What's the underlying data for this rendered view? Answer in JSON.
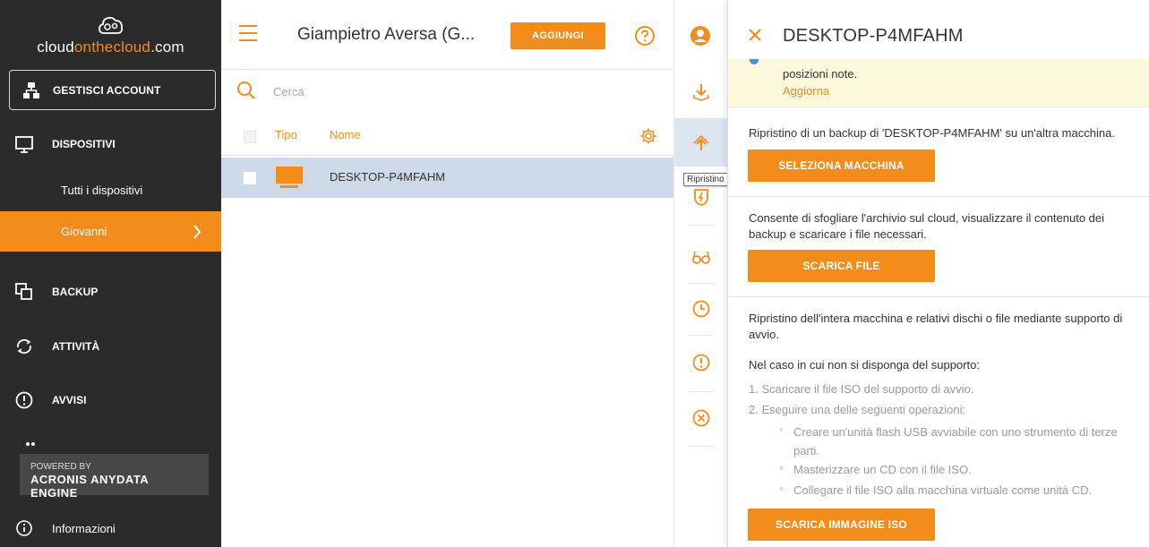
{
  "sidebar": {
    "logo": {
      "part1": "cloud",
      "part2": "onthecloud",
      "part3": ".com"
    },
    "manage_label": "GESTISCI ACCOUNT",
    "devices_label": "DISPOSITIVI",
    "all_devices_label": "Tutti i dispositivi",
    "active_group_label": "Giovanni",
    "backup_label": "BACKUP",
    "activities_label": "ATTIVITÀ",
    "alerts_label": "AVVISI",
    "powered_by": "POWERED BY",
    "engine": "ACRONIS ANYDATA ENGINE",
    "info_label": "Informazioni"
  },
  "topbar": {
    "account_name": "Giampietro Aversa (G...",
    "add_label": "AGGIUNGI"
  },
  "search": {
    "placeholder": "Cerca"
  },
  "table": {
    "columns": {
      "type": "Tipo",
      "name": "Nome"
    },
    "rows": [
      {
        "name": "DESKTOP-P4MFAHM"
      }
    ]
  },
  "strip": {
    "tooltip": "Ripristino"
  },
  "panel": {
    "title": "DESKTOP-P4MFAHM",
    "alert_text": "posizioni note.",
    "alert_link": "Aggiorna",
    "sec1_text": "Ripristino di un backup di 'DESKTOP-P4MFAHM' su un'altra macchina.",
    "sec1_button": "SELEZIONA MACCHINA",
    "sec2_text": "Consente di sfogliare l'archivio sul cloud, visualizzare il contenuto dei backup e scaricare i file necessari.",
    "sec2_button": "SCARICA FILE",
    "sec3_text": "Ripristino dell'intera macchina e relativi dischi o file mediante supporto di avvio.",
    "sec3_note": "Nel caso in cui non si disponga del supporto:",
    "step1": "1. Scaricare il file ISO del supporto di avvio.",
    "step2": "2. Eseguire una delle seguenti operazioni:",
    "sub1": "Creare un'unità flash USB avviabile con uno strumento di terze parti.",
    "sub2": "Masterizzare un CD con il file ISO.",
    "sub3": "Collegare il file ISO alla macchina virtuale come unità CD.",
    "sec3_button": "SCARICA IMMAGINE ISO"
  },
  "colors": {
    "accent": "#f28c1a",
    "sidebar_bg": "#2b2b2b",
    "selected_row": "#cdd9e7",
    "alert_bg": "#fbf8dc"
  }
}
